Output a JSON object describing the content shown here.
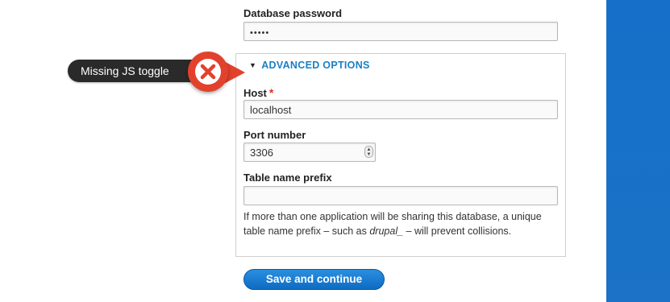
{
  "form": {
    "db_password": {
      "label": "Database password",
      "value": "•••••"
    },
    "advanced": {
      "legend": "ADVANCED OPTIONS",
      "triangle": "▼"
    },
    "host": {
      "label": "Host",
      "required_marker": "*",
      "value": "localhost"
    },
    "port": {
      "label": "Port number",
      "value": "3306",
      "stepper_up": "▲",
      "stepper_down": "▼"
    },
    "prefix": {
      "label": "Table name prefix",
      "value": "",
      "description_before": "If more than one application will be sharing this database, a unique table name prefix – such as ",
      "description_em": "drupal_",
      "description_after": " – will prevent collisions."
    },
    "save_button": "Save and continue"
  },
  "annotation": {
    "callout_text": "Missing JS toggle",
    "badge_icon": "close-icon"
  },
  "colors": {
    "accent_blue": "#1a7fc4",
    "button_blue": "#1475cf",
    "error_red": "#e2412c",
    "side_band": "#1670c9"
  }
}
